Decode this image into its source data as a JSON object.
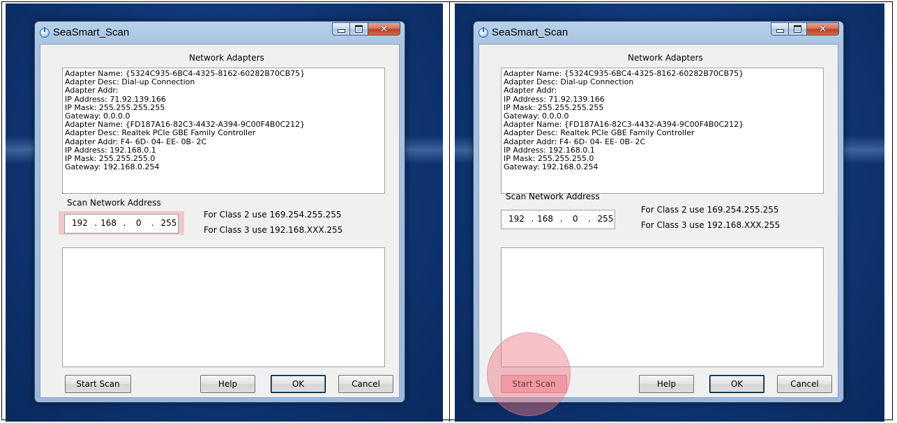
{
  "panels": [
    {
      "window": {
        "title": "SeaSmart_Scan",
        "adapters_label": "Network Adapters",
        "adapter_lines": [
          "Adapter Name: {5324C935-6BC4-4325-8162-60282B70CB75}",
          "Adapter Desc: Dial-up Connection",
          "Adapter Addr:",
          "IP Address: 71.92.139.166",
          "IP Mask: 255.255.255.255",
          "Gateway: 0.0.0.0",
          "Adapter Name: {FD187A16-82C3-4432-A394-9C00F4B0C212}",
          "Adapter Desc: Realtek PCIe GBE Family Controller",
          "Adapter Addr:  F4- 6D- 04- EE- 0B- 2C",
          "IP Address: 192.168.0.1",
          "IP Mask: 255.255.255.0",
          "Gateway: 192.168.0.254"
        ],
        "scan_label": "Scan Network Address",
        "ip_value": "192  . 168  .   0   .  255",
        "hint_class2": "For Class 2 use 169.254.255.255",
        "hint_class3": "For Class 3 use 192.168.XXX.255",
        "buttons": {
          "start_scan": "Start Scan",
          "help": "Help",
          "ok": "OK",
          "cancel": "Cancel"
        },
        "highlight": "ip-field"
      }
    },
    {
      "window": {
        "title": "SeaSmart_Scan",
        "adapters_label": "Network Adapters",
        "adapter_lines": [
          "Adapter Name: {5324C935-6BC4-4325-8162-60282B70CB75}",
          "Adapter Desc: Dial-up Connection",
          "Adapter Addr:",
          "IP Address: 71.92.139.166",
          "IP Mask: 255.255.255.255",
          "Gateway: 0.0.0.0",
          "Adapter Name: {FD187A16-82C3-4432-A394-9C00F4B0C212}",
          "Adapter Desc: Realtek PCIe GBE Family Controller",
          "Adapter Addr:  F4- 6D- 04- EE- 0B- 2C",
          "IP Address: 192.168.0.1",
          "IP Mask: 255.255.255.0",
          "Gateway: 192.168.0.254"
        ],
        "scan_label": "Scan Network Address",
        "ip_value": "192  . 168  .   0   .  255",
        "hint_class2": "For Class 2 use 169.254.255.255",
        "hint_class3": "For Class 3 use 192.168.XXX.255",
        "buttons": {
          "start_scan": "Start Scan",
          "help": "Help",
          "ok": "OK",
          "cancel": "Cancel"
        },
        "highlight": "start-scan-button"
      }
    }
  ],
  "colors": {
    "desktop": "#0f3574",
    "highlight": "#f2c7cb",
    "click_marker": "#eb7882"
  }
}
